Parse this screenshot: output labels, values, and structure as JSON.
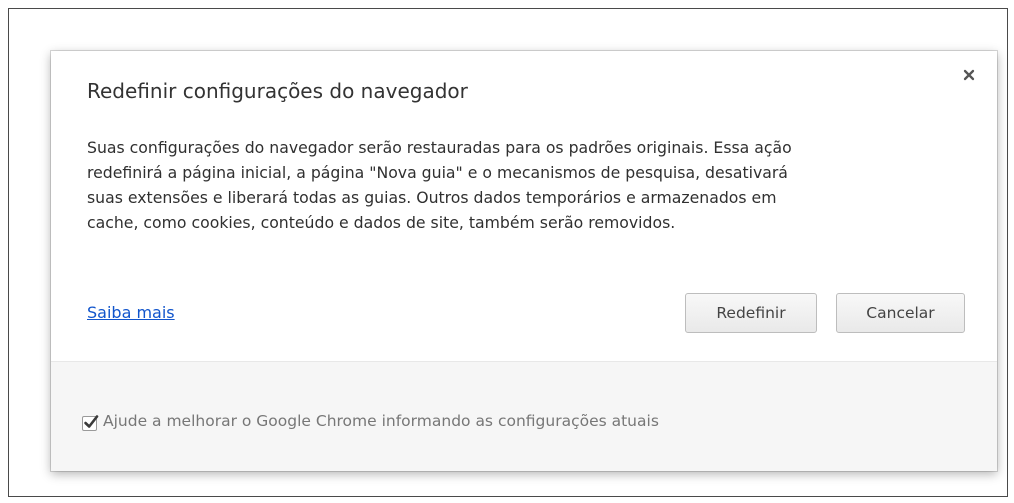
{
  "dialog": {
    "title": "Redefinir configurações do navegador",
    "close_icon": "close-icon",
    "body_lines": [
      "Suas configurações do navegador serão restauradas para os padrões originais. Essa ação",
      "redefinirá a página inicial, a página \"Nova guia\" e o mecanismos de pesquisa, desativará",
      "suas extensões e liberará todas as guias. Outros dados temporários e armazenados em",
      "cache, como cookies, conteúdo e dados de site, também serão removidos."
    ],
    "learn_more_label": "Saiba mais",
    "reset_label": "Redefinir",
    "cancel_label": "Cancelar"
  },
  "footer": {
    "checkbox_checked": true,
    "checkbox_label": "Ajude a melhorar o Google Chrome informando as configurações atuais"
  },
  "colors": {
    "link": "#1155cc",
    "footer_background": "#f6f6f6"
  }
}
